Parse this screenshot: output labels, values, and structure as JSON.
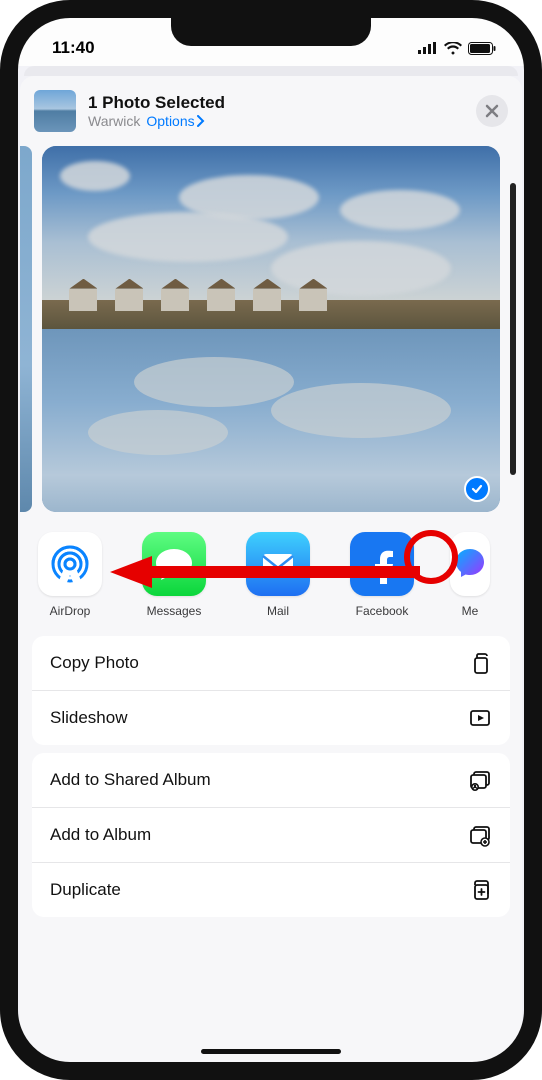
{
  "status": {
    "time": "11:40"
  },
  "header": {
    "title": "1 Photo Selected",
    "location": "Warwick",
    "options_label": "Options"
  },
  "apps": [
    {
      "label": "AirDrop"
    },
    {
      "label": "Messages"
    },
    {
      "label": "Mail"
    },
    {
      "label": "Facebook"
    },
    {
      "label": "Me"
    }
  ],
  "actions_group1": [
    {
      "label": "Copy Photo"
    },
    {
      "label": "Slideshow"
    }
  ],
  "actions_group2": [
    {
      "label": "Add to Shared Album"
    },
    {
      "label": "Add to Album"
    },
    {
      "label": "Duplicate"
    }
  ]
}
